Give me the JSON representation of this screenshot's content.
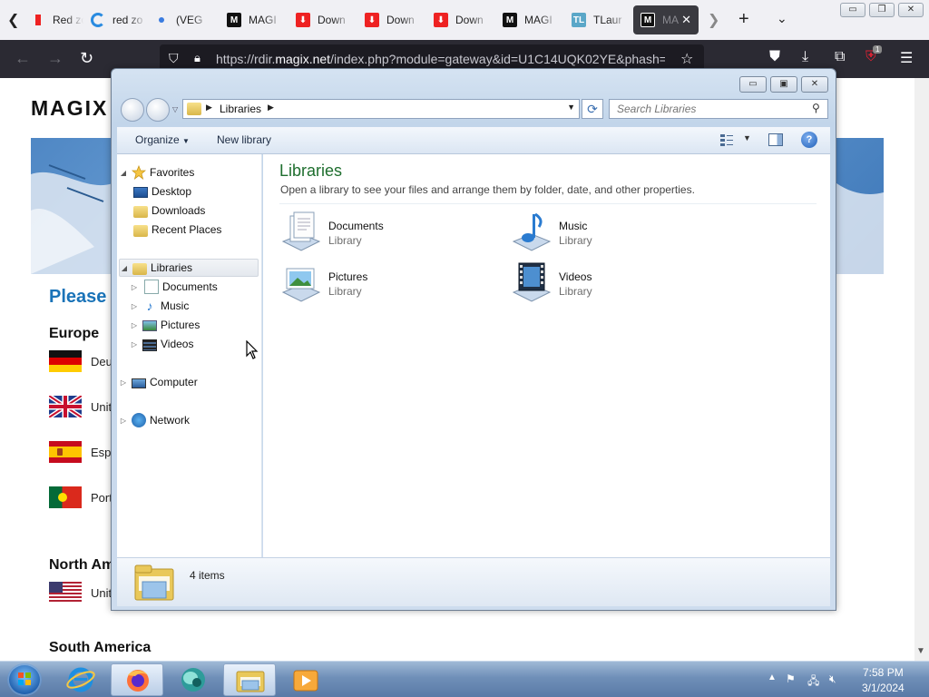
{
  "browser": {
    "tabs": [
      {
        "title": "Red zo",
        "favicon": "red-square"
      },
      {
        "title": "red zo",
        "favicon": "loading-spinner"
      },
      {
        "title": "(VEG",
        "favicon": "blue-dot"
      },
      {
        "title": "MAGI",
        "favicon": "magix-m"
      },
      {
        "title": "Down",
        "favicon": "download-red"
      },
      {
        "title": "Down",
        "favicon": "download-red"
      },
      {
        "title": "Down",
        "favicon": "download-red"
      },
      {
        "title": "MAGI",
        "favicon": "magix-m"
      },
      {
        "title": "TLaur",
        "favicon": "tl"
      },
      {
        "title": "MA",
        "favicon": "magix-m",
        "active": true
      }
    ],
    "tab_close": "✕",
    "new_tab": "+",
    "list_tabs": "⌄",
    "url_prefix": "https://rdir.",
    "url_domain": "magix.net",
    "url_rest": "/index.php?module=gateway&id=U1C14UQK02YE&phash=",
    "ublock_count": "1",
    "window_controls": {
      "min": "▭",
      "max": "❐",
      "close": "✕"
    }
  },
  "webpage": {
    "logo": "MAGIX",
    "please": "Please",
    "regions": [
      {
        "name": "Europe"
      },
      {
        "name": "North Am"
      },
      {
        "name": "South America"
      }
    ],
    "countries": [
      {
        "label": "Deu",
        "flag": "germany"
      },
      {
        "label": "Unit",
        "flag": "uk"
      },
      {
        "label": "Esp",
        "flag": "spain"
      },
      {
        "label": "Port",
        "flag": "portugal"
      },
      {
        "label": "Unit",
        "flag": "usa"
      }
    ]
  },
  "explorer": {
    "window_controls": {
      "min": "▭",
      "max": "▣",
      "close": "✕"
    },
    "address_segment": "Libraries",
    "search_placeholder": "Search Libraries",
    "toolbar": {
      "organize": "Organize",
      "new_library": "New library"
    },
    "nav": {
      "favorites": "Favorites",
      "desktop": "Desktop",
      "downloads": "Downloads",
      "recent_places": "Recent Places",
      "libraries": "Libraries",
      "documents": "Documents",
      "music": "Music",
      "pictures": "Pictures",
      "videos": "Videos",
      "computer": "Computer",
      "network": "Network"
    },
    "content": {
      "title": "Libraries",
      "subtitle": "Open a library to see your files and arrange them by folder, date, and other properties.",
      "items": [
        {
          "name": "Documents",
          "type": "Library",
          "icon": "documents-library-icon"
        },
        {
          "name": "Music",
          "type": "Library",
          "icon": "music-library-icon"
        },
        {
          "name": "Pictures",
          "type": "Library",
          "icon": "pictures-library-icon"
        },
        {
          "name": "Videos",
          "type": "Library",
          "icon": "videos-library-icon"
        }
      ]
    },
    "details": {
      "count": "4 items"
    }
  },
  "taskbar": {
    "apps": [
      "internet-explorer",
      "firefox",
      "app-orb",
      "windows-explorer",
      "media-player"
    ],
    "clock_time": "7:58 PM",
    "clock_date": "3/1/2024"
  },
  "colors": {
    "browser_dark": "#2b2a33",
    "library_title": "#1e6e2e",
    "link_blue": "#1a73b8"
  }
}
